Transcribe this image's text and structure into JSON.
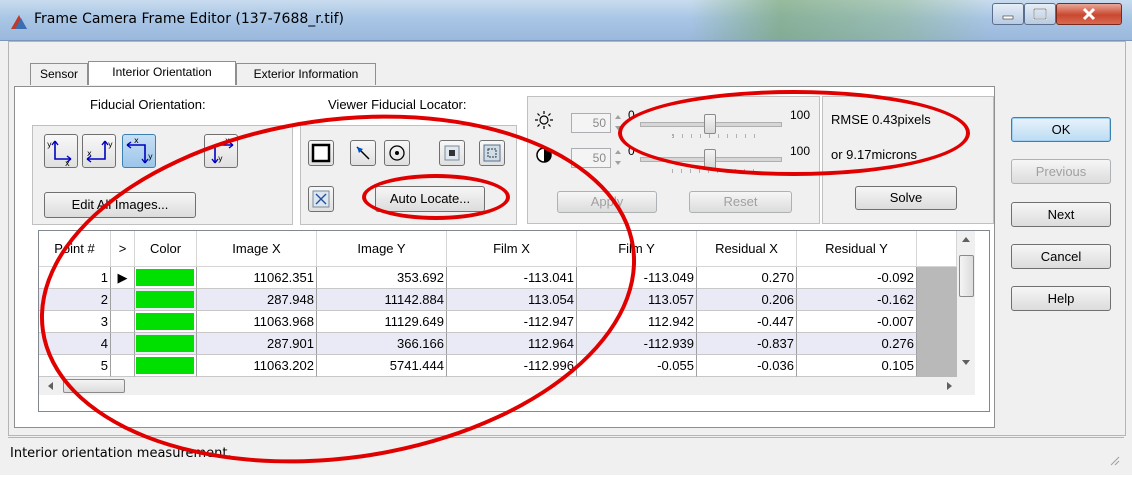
{
  "window": {
    "title": "Frame Camera Frame Editor (137-7688_r.tif)",
    "controls": {
      "minimize": "minimize-icon",
      "maximize": "maximize-icon",
      "close": "close-icon"
    }
  },
  "tabs": [
    "Sensor",
    "Interior Orientation",
    "Exterior Information"
  ],
  "active_tab": "Interior Orientation",
  "fiducial_orientation": {
    "label": "Fiducial Orientation:",
    "edit_all_label": "Edit All Images..."
  },
  "viewer_locator": {
    "label": "Viewer Fiducial Locator:",
    "auto_locate_label": "Auto Locate..."
  },
  "contrast": {
    "brightness": {
      "value": "50",
      "min_label": "0",
      "max_label": "100"
    },
    "contrast": {
      "value": "50",
      "min_label": "0",
      "max_label": "100"
    },
    "apply_label": "Apply",
    "reset_label": "Reset"
  },
  "rmse": {
    "line1": "RMSE 0.43pixels",
    "line2": "or 9.17microns",
    "solve_label": "Solve"
  },
  "side_buttons": {
    "ok": "OK",
    "previous": "Previous",
    "next": "Next",
    "cancel": "Cancel",
    "help": "Help"
  },
  "table": {
    "columns": [
      "Point #",
      ">",
      "Color",
      "Image X",
      "Image Y",
      "Film X",
      "Film Y",
      "Residual X",
      "Residual Y"
    ],
    "rows": [
      {
        "point": "1",
        "marker": "▶",
        "image_x": "11062.351",
        "image_y": "353.692",
        "film_x": "-113.041",
        "film_y": "-113.049",
        "res_x": "0.270",
        "res_y": "-0.092"
      },
      {
        "point": "2",
        "marker": "",
        "image_x": "287.948",
        "image_y": "11142.884",
        "film_x": "113.054",
        "film_y": "113.057",
        "res_x": "0.206",
        "res_y": "-0.162"
      },
      {
        "point": "3",
        "marker": "",
        "image_x": "11063.968",
        "image_y": "11129.649",
        "film_x": "-112.947",
        "film_y": "112.942",
        "res_x": "-0.447",
        "res_y": "-0.007"
      },
      {
        "point": "4",
        "marker": "",
        "image_x": "287.901",
        "image_y": "366.166",
        "film_x": "112.964",
        "film_y": "-112.939",
        "res_x": "-0.837",
        "res_y": "0.276"
      },
      {
        "point": "5",
        "marker": "",
        "image_x": "11063.202",
        "image_y": "5741.444",
        "film_x": "-112.996",
        "film_y": "-0.055",
        "res_x": "-0.036",
        "res_y": "0.105"
      }
    ],
    "swatch_color": "#00e000"
  },
  "status": "Interior orientation measurement.",
  "annotation_color": "#e00000"
}
